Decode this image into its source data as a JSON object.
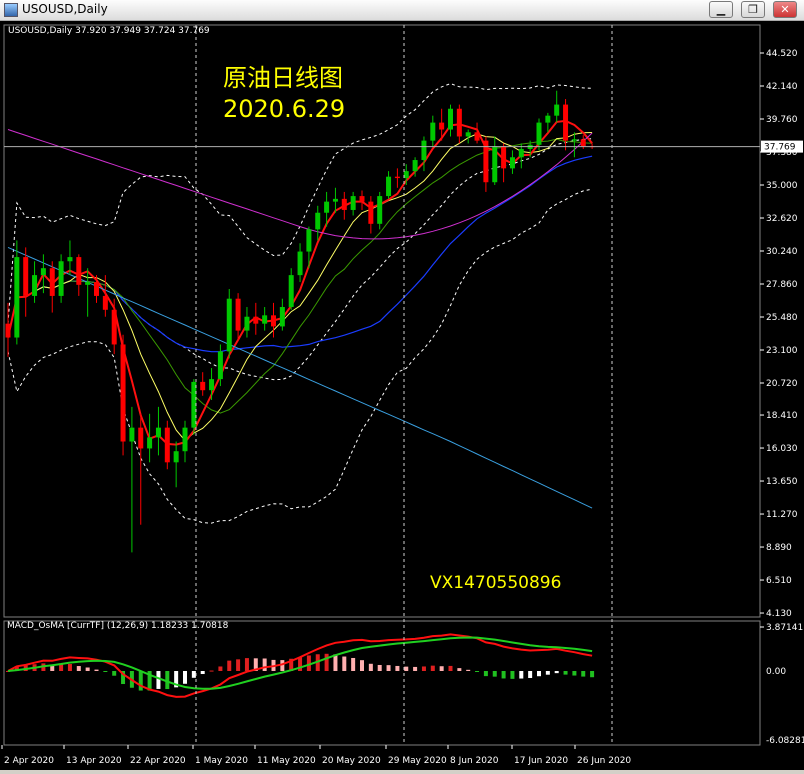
{
  "window": {
    "title": "USOUSD,Daily",
    "minimize": "▁",
    "restore": "❐",
    "close": "✕"
  },
  "info": "USOUSD,Daily  37.920 37.949 37.724 37.769",
  "overlay": {
    "line1": "原油日线图",
    "line2": "2020.6.29",
    "contact": "VX1470550896"
  },
  "colors": {
    "bg": "#000000",
    "bull": "#00c800",
    "bear": "#ff0000",
    "overlay_text": "#ffff00"
  },
  "chart_data": {
    "type": "candlestick",
    "price_axis": {
      "ticks": [
        "44.520",
        "42.140",
        "39.760",
        "37.380",
        "35.000",
        "32.620",
        "30.240",
        "27.860",
        "25.480",
        "23.100",
        "20.720",
        "18.410",
        "16.030",
        "13.650",
        "11.270",
        "8.890",
        "6.510",
        "4.130"
      ],
      "last_price": "37.769"
    },
    "macd": {
      "label": "MACD_OsMA [CurrTF] (12,26,9) 1.18233 1.70818",
      "ticks": [
        "3.87141",
        "0.00",
        "-6.08281"
      ]
    },
    "x_labels": [
      "2 Apr 2020",
      "13 Apr 2020",
      "22 Apr 2020",
      "1 May 2020",
      "11 May 2020",
      "20 May 2020",
      "29 May 2020",
      "8 Jun 2020",
      "17 Jun 2020",
      "26 Jun 2020"
    ],
    "candles": [
      [
        25.0,
        26.5,
        22.6,
        24.0
      ],
      [
        24.0,
        31.0,
        23.5,
        29.8
      ],
      [
        29.8,
        30.5,
        25.5,
        27.0
      ],
      [
        27.0,
        29.5,
        26.5,
        28.5
      ],
      [
        28.5,
        30.0,
        27.2,
        29.0
      ],
      [
        29.0,
        29.5,
        25.8,
        27.0
      ],
      [
        27.0,
        30.0,
        26.5,
        29.5
      ],
      [
        29.5,
        31.0,
        28.5,
        29.8
      ],
      [
        29.8,
        30.0,
        27.0,
        27.8
      ],
      [
        27.8,
        29.0,
        25.5,
        28.0
      ],
      [
        28.0,
        28.5,
        26.5,
        27.0
      ],
      [
        27.0,
        28.5,
        25.5,
        26.0
      ],
      [
        26.0,
        26.8,
        22.8,
        23.5
      ],
      [
        23.5,
        24.2,
        15.5,
        16.5
      ],
      [
        16.5,
        19.0,
        8.5,
        17.5
      ],
      [
        17.5,
        18.5,
        10.5,
        16.0
      ],
      [
        16.0,
        18.5,
        15.0,
        16.8
      ],
      [
        16.8,
        19.0,
        15.5,
        17.5
      ],
      [
        17.5,
        18.0,
        14.5,
        15.0
      ],
      [
        15.0,
        16.5,
        13.2,
        15.8
      ],
      [
        15.8,
        18.0,
        15.0,
        17.5
      ],
      [
        17.5,
        21.0,
        17.0,
        20.8
      ],
      [
        20.8,
        21.5,
        19.8,
        20.2
      ],
      [
        20.2,
        21.8,
        19.5,
        21.0
      ],
      [
        21.0,
        23.5,
        20.5,
        23.0
      ],
      [
        23.0,
        27.5,
        22.5,
        26.8
      ],
      [
        26.8,
        27.2,
        23.8,
        24.5
      ],
      [
        24.5,
        26.2,
        24.0,
        25.5
      ],
      [
        25.5,
        26.5,
        24.2,
        25.0
      ],
      [
        25.0,
        26.2,
        24.5,
        25.6
      ],
      [
        25.6,
        26.5,
        24.0,
        24.8
      ],
      [
        24.8,
        26.8,
        24.5,
        26.2
      ],
      [
        26.2,
        29.0,
        26.0,
        28.5
      ],
      [
        28.5,
        30.8,
        28.0,
        30.2
      ],
      [
        30.2,
        32.0,
        29.0,
        31.8
      ],
      [
        31.8,
        33.5,
        31.0,
        33.0
      ],
      [
        33.0,
        34.5,
        32.0,
        33.8
      ],
      [
        33.8,
        34.8,
        33.0,
        34.0
      ],
      [
        34.0,
        34.5,
        32.5,
        33.2
      ],
      [
        33.2,
        34.5,
        32.8,
        34.2
      ],
      [
        34.2,
        34.6,
        33.2,
        33.8
      ],
      [
        33.8,
        34.2,
        31.5,
        32.2
      ],
      [
        32.2,
        34.5,
        31.8,
        34.2
      ],
      [
        34.2,
        36.0,
        34.0,
        35.6
      ],
      [
        35.6,
        36.2,
        34.8,
        35.5
      ],
      [
        35.5,
        36.5,
        35.0,
        36.0
      ],
      [
        36.0,
        37.0,
        35.6,
        36.8
      ],
      [
        36.8,
        38.5,
        36.0,
        38.2
      ],
      [
        38.2,
        40.0,
        37.8,
        39.5
      ],
      [
        39.5,
        40.5,
        38.2,
        39.0
      ],
      [
        39.0,
        40.8,
        38.5,
        40.5
      ],
      [
        40.5,
        40.8,
        38.0,
        38.5
      ],
      [
        38.5,
        39.0,
        38.0,
        38.8
      ],
      [
        38.8,
        39.5,
        38.0,
        38.2
      ],
      [
        38.2,
        38.5,
        34.5,
        35.2
      ],
      [
        35.2,
        38.5,
        35.0,
        37.8
      ],
      [
        37.8,
        38.0,
        35.2,
        36.2
      ],
      [
        36.2,
        37.5,
        35.8,
        37.0
      ],
      [
        37.0,
        38.0,
        36.2,
        37.6
      ],
      [
        37.6,
        38.2,
        37.0,
        37.9
      ],
      [
        37.9,
        39.8,
        37.5,
        39.5
      ],
      [
        39.5,
        40.2,
        38.8,
        40.0
      ],
      [
        40.0,
        41.8,
        39.5,
        40.8
      ],
      [
        40.8,
        41.2,
        37.5,
        38.2
      ],
      [
        38.2,
        38.8,
        37.0,
        38.3
      ],
      [
        38.3,
        38.6,
        37.6,
        37.8
      ],
      [
        37.8,
        38.0,
        37.6,
        37.769
      ]
    ],
    "overlays": [
      "ma_red",
      "ma_yellow",
      "ma_green",
      "ma_blue",
      "ma_lightblue",
      "ma_magenta",
      "bb_upper",
      "bb_middle",
      "bb_lower"
    ]
  },
  "x_labels_shown": true
}
